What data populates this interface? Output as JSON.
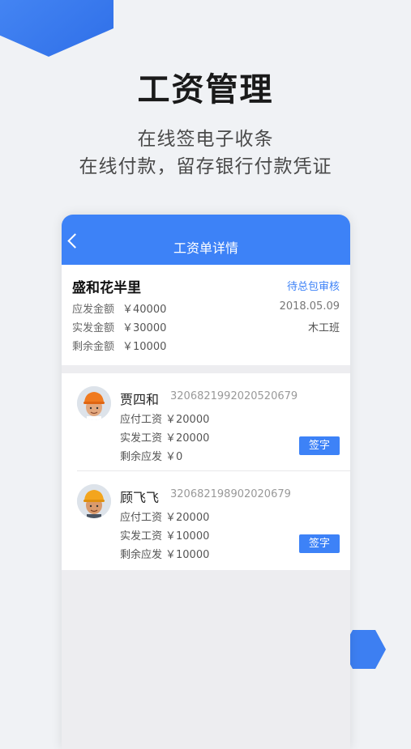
{
  "hero": {
    "title": "工资管理",
    "subtitle_line1": "在线签电子收条",
    "subtitle_line2": "在线付款，留存银行付款凭证"
  },
  "colors": {
    "accent": "#3d82f7",
    "background": "#f0f2f5"
  },
  "nav": {
    "title": "工资单详情",
    "back_icon": "chevron-left-icon"
  },
  "summary": {
    "project_name": "盛和花半里",
    "status": "待总包审核",
    "rows": [
      {
        "label": "应发金额",
        "value": "￥40000"
      },
      {
        "label": "实发金额",
        "value": "￥30000"
      },
      {
        "label": "剩余金额",
        "value": "￥10000"
      }
    ],
    "date": "2018.05.09",
    "team": "木工班"
  },
  "workers": [
    {
      "name": "贾四和",
      "id_number": "3206821992020520679",
      "payable_label": "应付工资",
      "payable": "￥20000",
      "paid_label": "实发工资",
      "paid": "￥20000",
      "remaining_label": "剩余应发",
      "remaining": "￥0",
      "sign_label": "签字"
    },
    {
      "name": "顾飞飞",
      "id_number": "320682198902020679",
      "payable_label": "应付工资",
      "payable": "￥20000",
      "paid_label": "实发工资",
      "paid": "￥10000",
      "remaining_label": "剩余应发",
      "remaining": "￥10000",
      "sign_label": "签字"
    }
  ]
}
